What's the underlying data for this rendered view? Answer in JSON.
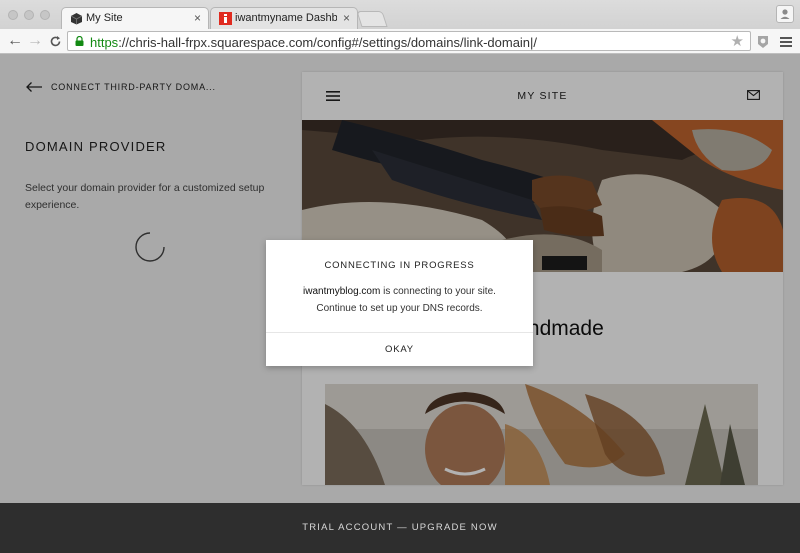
{
  "browser": {
    "tabs": [
      {
        "title": "My Site",
        "close": "×"
      },
      {
        "title": "iwantmyname Dashboard |",
        "close": "×"
      }
    ],
    "url": {
      "scheme": "https",
      "rest": "://chris-hall-frpx.squarespace.com/config#/settings/domains/link-domain|/"
    }
  },
  "sidebar": {
    "back_label": "CONNECT THIRD-PARTY DOMA...",
    "title": "DOMAIN PROVIDER",
    "description": "Select your domain provider for a customized setup experience."
  },
  "preview": {
    "site_title": "MY SITE",
    "heading_visible": "& Handmade"
  },
  "modal": {
    "title": "CONNECTING IN PROGRESS",
    "domain": "iwantmyblog.com",
    "message_line1_rest": " is connecting to your site.",
    "message_line2": "Continue to set up your DNS records.",
    "button": "OKAY"
  },
  "footer": {
    "banner": "TRIAL ACCOUNT — UPGRADE NOW"
  },
  "colors": {
    "overlay": "#000000",
    "footer_bg": "#2e2e2e",
    "secure_green": "#138a13"
  }
}
